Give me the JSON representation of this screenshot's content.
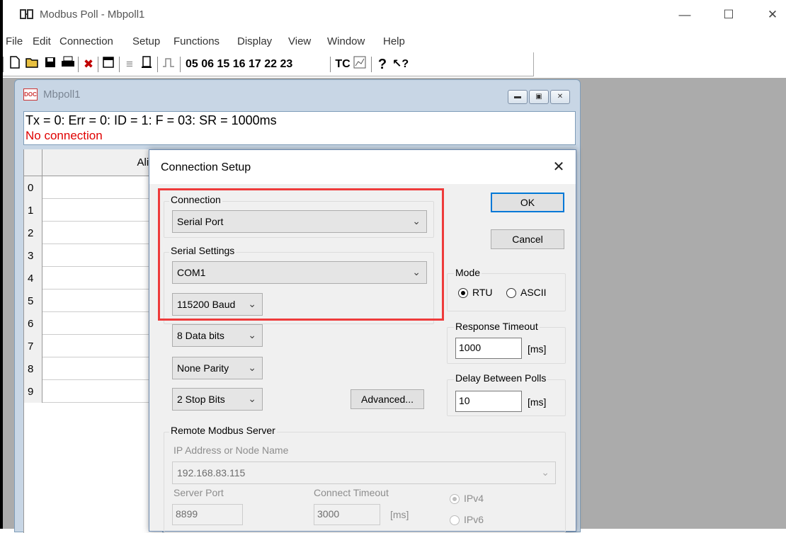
{
  "window": {
    "title": "Modbus Poll - Mbpoll1",
    "app_icon": "modbus-app-icon"
  },
  "menu": [
    "File",
    "Edit",
    "Connection",
    "Setup",
    "Functions",
    "Display",
    "View",
    "Window",
    "Help"
  ],
  "toolbar": {
    "function_codes": "05 06 15 16 17 22 23",
    "tc_label": "TC"
  },
  "child": {
    "title": "Mbpoll1",
    "status_line": "Tx = 0: Err = 0: ID = 1: F = 03: SR = 1000ms",
    "connection_status": "No connection",
    "grid": {
      "alias_header": "Alias",
      "rows": [
        "0",
        "1",
        "2",
        "3",
        "4",
        "5",
        "6",
        "7",
        "8",
        "9"
      ]
    }
  },
  "dialog": {
    "title": "Connection Setup",
    "connection_group": "Connection",
    "connection_value": "Serial Port",
    "serial_group": "Serial Settings",
    "port_value": "COM1",
    "baud_value": "115200 Baud",
    "data_bits_value": "8 Data bits",
    "parity_value": "None Parity",
    "stop_bits_value": "2 Stop Bits",
    "advanced_label": "Advanced...",
    "ok_label": "OK",
    "cancel_label": "Cancel",
    "mode_group": "Mode",
    "mode_rtu": "RTU",
    "mode_ascii": "ASCII",
    "mode_selected": "RTU",
    "response_timeout_group": "Response Timeout",
    "response_timeout_value": "1000",
    "response_timeout_unit": "[ms]",
    "delay_group": "Delay Between Polls",
    "delay_value": "10",
    "delay_unit": "[ms]",
    "remote_group": "Remote Modbus Server",
    "ip_label": "IP Address or Node Name",
    "ip_value": "192.168.83.115",
    "server_port_label": "Server Port",
    "server_port_value": "8899",
    "connect_timeout_label": "Connect Timeout",
    "connect_timeout_value": "3000",
    "connect_timeout_unit": "[ms]",
    "ipv4_label": "IPv4",
    "ipv6_label": "IPv6"
  },
  "colors": {
    "highlight": "#ee3b3b",
    "error_text": "#e00000",
    "mdi_background": "#ababab"
  }
}
